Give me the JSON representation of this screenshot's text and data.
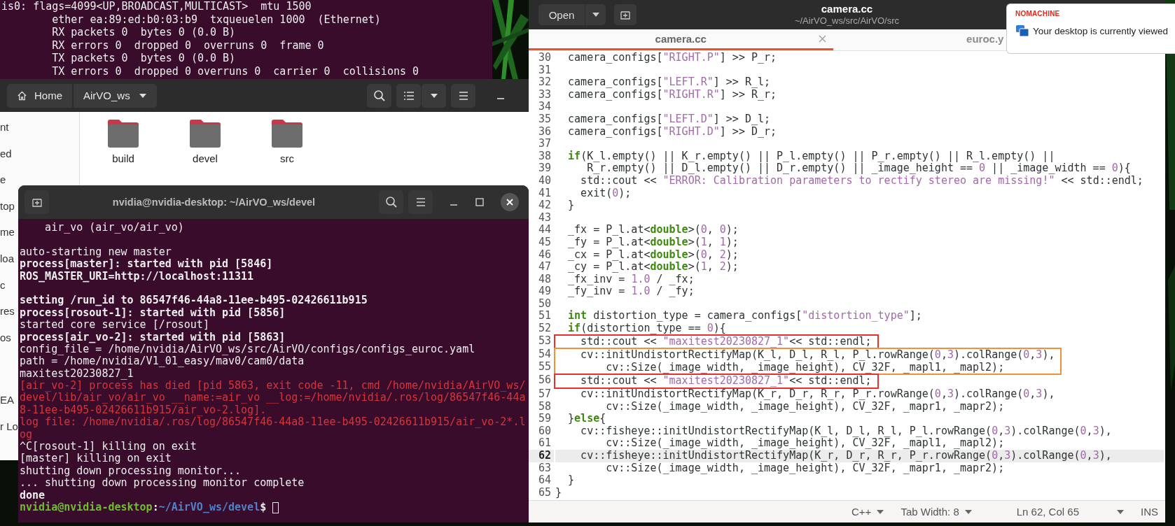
{
  "background_terminal": {
    "lines": [
      {
        "text": "is0: flags=4099<UP,BROADCAST,MULTICAST>  mtu 1500"
      },
      {
        "text": "        ether ea:89:ed:b0:03:b9  txqueuelen 1000  (Ethernet)"
      },
      {
        "text": "        RX packets 0  bytes 0 (0.0 B)"
      },
      {
        "text": "        RX errors 0  dropped 0  overruns 0  frame 0"
      },
      {
        "text": "        TX packets 0  bytes 0 (0.0 B)"
      },
      {
        "text": "        TX errors 0  dropped 0 overruns 0  carrier 0  collisions 0"
      }
    ]
  },
  "file_manager": {
    "breadcrumbs": [
      {
        "label": "Home",
        "kind": "home"
      },
      {
        "label": "AirVO_ws",
        "kind": "current"
      }
    ],
    "sidebar": {
      "items": [
        {
          "label": "nt"
        },
        {
          "label": "ed"
        },
        {
          "label": "e"
        },
        {
          "label": "top"
        },
        {
          "label": "me"
        },
        {
          "label": "loa"
        },
        {
          "label": "c"
        },
        {
          "label": "res"
        },
        {
          "label": "os"
        }
      ],
      "other": [
        {
          "label": "EA"
        },
        {
          "label": "r Lo"
        }
      ]
    },
    "folders": [
      {
        "name": "build"
      },
      {
        "name": "devel"
      },
      {
        "name": "src"
      }
    ]
  },
  "terminal": {
    "title": "nvidia@nvidia-desktop: ~/AirVO_ws/devel",
    "lines": [
      {
        "kind": "plain",
        "text": "    air_vo (air_vo/air_vo)"
      },
      {
        "kind": "blank"
      },
      {
        "kind": "plain",
        "text": "auto-starting new master"
      },
      {
        "kind": "bold",
        "text": "process[master]: started with pid [5846]"
      },
      {
        "kind": "bold",
        "text": "ROS_MASTER_URI=http://localhost:11311"
      },
      {
        "kind": "blank"
      },
      {
        "kind": "bold",
        "text": "setting /run_id to 86547f46-44a8-11ee-b495-02426611b915"
      },
      {
        "kind": "bold",
        "text": "process[rosout-1]: started with pid [5856]"
      },
      {
        "kind": "plain",
        "text": "started core service [/rosout]"
      },
      {
        "kind": "bold",
        "text": "process[air_vo-2]: started with pid [5863]"
      },
      {
        "kind": "plain",
        "text": "config_file = /home/nvidia/AirVO_ws/src/AirVO/configs/configs_euroc.yaml"
      },
      {
        "kind": "plain",
        "text": "path = /home/nvidia/V1_01_easy/mav0/cam0/data"
      },
      {
        "kind": "plain",
        "text": "maxitest20230827_1"
      },
      {
        "kind": "error",
        "text": "[air_vo-2] process has died [pid 5863, exit code -11, cmd /home/nvidia/AirVO_ws/"
      },
      {
        "kind": "error",
        "text": "devel/lib/air_vo/air_vo __name:=air_vo __log:=/home/nvidia/.ros/log/86547f46-44a"
      },
      {
        "kind": "error",
        "text": "8-11ee-b495-02426611b915/air_vo-2.log]."
      },
      {
        "kind": "error",
        "text": "log file: /home/nvidia/.ros/log/86547f46-44a8-11ee-b495-02426611b915/air_vo-2*.l"
      },
      {
        "kind": "error",
        "text": "og"
      },
      {
        "kind": "plain",
        "text": "^C[rosout-1] killing on exit"
      },
      {
        "kind": "plain",
        "text": "[master] killing on exit"
      },
      {
        "kind": "plain",
        "text": "shutting down processing monitor..."
      },
      {
        "kind": "plain",
        "text": "... shutting down processing monitor complete"
      },
      {
        "kind": "bold",
        "text": "done"
      }
    ],
    "prompt": {
      "user": "nvidia@nvidia-desktop",
      "separator": ":",
      "path": "~/AirVO_ws/devel",
      "symbol": "$"
    }
  },
  "editor": {
    "open_button": "Open",
    "title": "camera.cc",
    "subtitle": "~/AirVO_ws/src/AirVO/src",
    "tabs": [
      {
        "label": "camera.cc",
        "selected": true
      },
      {
        "label": "euroc.y",
        "selected": false
      }
    ],
    "code_blocks": [
      {
        "lines": [
          {
            "number": "30",
            "current": false,
            "tokens": [
              {
                "kind": "plain",
                "text": "  camera_configs["
              },
              {
                "kind": "string",
                "text": "\"RIGHT.P\""
              },
              {
                "kind": "plain",
                "text": "] >> P_r;"
              }
            ]
          },
          {
            "number": "31",
            "current": false
          },
          {
            "number": "32",
            "current": false,
            "tokens": [
              {
                "kind": "plain",
                "text": "  camera_configs["
              },
              {
                "kind": "string",
                "text": "\"LEFT.R\""
              },
              {
                "kind": "plain",
                "text": "] >> R_l;"
              }
            ]
          },
          {
            "number": "33",
            "current": false,
            "tokens": [
              {
                "kind": "plain",
                "text": "  camera_configs["
              },
              {
                "kind": "string",
                "text": "\"RIGHT.R\""
              },
              {
                "kind": "plain",
                "text": "] >> R_r;"
              }
            ]
          },
          {
            "number": "34",
            "current": false
          },
          {
            "number": "35",
            "current": false,
            "tokens": [
              {
                "kind": "plain",
                "text": "  camera_configs["
              },
              {
                "kind": "string",
                "text": "\"LEFT.D\""
              },
              {
                "kind": "plain",
                "text": "] >> D_l;"
              }
            ]
          },
          {
            "number": "36",
            "current": false,
            "tokens": [
              {
                "kind": "plain",
                "text": "  camera_configs["
              },
              {
                "kind": "string",
                "text": "\"RIGHT.D\""
              },
              {
                "kind": "plain",
                "text": "] >> D_r;"
              }
            ]
          },
          {
            "number": "37",
            "current": false
          },
          {
            "number": "38",
            "current": false,
            "tokens": [
              {
                "kind": "keyword",
                "text": "  if"
              },
              {
                "kind": "plain",
                "text": "(K_l.empty() || K_r.empty() || P_l.empty() || P_r.empty() || R_l.empty() ||"
              }
            ]
          },
          {
            "number": "39",
            "current": false,
            "tokens": [
              {
                "kind": "plain",
                "text": "     R_r.empty() || D_l.empty() || D_r.empty() || _image_height == "
              },
              {
                "kind": "number",
                "text": "0"
              },
              {
                "kind": "plain",
                "text": " || _image_width == "
              },
              {
                "kind": "number",
                "text": "0"
              },
              {
                "kind": "plain",
                "text": "){"
              }
            ]
          },
          {
            "number": "40",
            "current": false,
            "tokens": [
              {
                "kind": "plain",
                "text": "    std::cout << "
              },
              {
                "kind": "string",
                "text": "\"ERROR: Calibration parameters to rectify stereo are missing!\""
              },
              {
                "kind": "plain",
                "text": " << std::endl;"
              }
            ]
          },
          {
            "number": "41",
            "current": false,
            "tokens": [
              {
                "kind": "plain",
                "text": "    exit("
              },
              {
                "kind": "number",
                "text": "0"
              },
              {
                "kind": "plain",
                "text": ");"
              }
            ]
          },
          {
            "number": "42",
            "current": false,
            "tokens": [
              {
                "kind": "plain",
                "text": "  }"
              }
            ]
          },
          {
            "number": "43",
            "current": false
          },
          {
            "number": "44",
            "current": false,
            "tokens": [
              {
                "kind": "plain",
                "text": "  _fx = P_l.at<"
              },
              {
                "kind": "keyword",
                "text": "double"
              },
              {
                "kind": "plain",
                "text": ">("
              },
              {
                "kind": "number",
                "text": "0"
              },
              {
                "kind": "plain",
                "text": ", "
              },
              {
                "kind": "number",
                "text": "0"
              },
              {
                "kind": "plain",
                "text": ");"
              }
            ]
          },
          {
            "number": "45",
            "current": false,
            "tokens": [
              {
                "kind": "plain",
                "text": "  _fy = P_l.at<"
              },
              {
                "kind": "keyword",
                "text": "double"
              },
              {
                "kind": "plain",
                "text": ">("
              },
              {
                "kind": "number",
                "text": "1"
              },
              {
                "kind": "plain",
                "text": ", "
              },
              {
                "kind": "number",
                "text": "1"
              },
              {
                "kind": "plain",
                "text": ");"
              }
            ]
          },
          {
            "number": "46",
            "current": false,
            "tokens": [
              {
                "kind": "plain",
                "text": "  _cx = P_l.at<"
              },
              {
                "kind": "keyword",
                "text": "double"
              },
              {
                "kind": "plain",
                "text": ">("
              },
              {
                "kind": "number",
                "text": "0"
              },
              {
                "kind": "plain",
                "text": ", "
              },
              {
                "kind": "number",
                "text": "2"
              },
              {
                "kind": "plain",
                "text": ");"
              }
            ]
          },
          {
            "number": "47",
            "current": false,
            "tokens": [
              {
                "kind": "plain",
                "text": "  _cy = P_l.at<"
              },
              {
                "kind": "keyword",
                "text": "double"
              },
              {
                "kind": "plain",
                "text": ">("
              },
              {
                "kind": "number",
                "text": "1"
              },
              {
                "kind": "plain",
                "text": ", "
              },
              {
                "kind": "number",
                "text": "2"
              },
              {
                "kind": "plain",
                "text": ");"
              }
            ]
          },
          {
            "number": "48",
            "current": false,
            "tokens": [
              {
                "kind": "plain",
                "text": "  _fx_inv = "
              },
              {
                "kind": "number",
                "text": "1.0"
              },
              {
                "kind": "plain",
                "text": " / _fx;"
              }
            ]
          },
          {
            "number": "49",
            "current": false,
            "tokens": [
              {
                "kind": "plain",
                "text": "  _fy_inv = "
              },
              {
                "kind": "number",
                "text": "1.0"
              },
              {
                "kind": "plain",
                "text": " / _fy;"
              }
            ]
          },
          {
            "number": "50",
            "current": false
          },
          {
            "number": "51",
            "current": false,
            "tokens": [
              {
                "kind": "keyword",
                "text": "  int"
              },
              {
                "kind": "plain",
                "text": " distortion_type = camera_configs["
              },
              {
                "kind": "string",
                "text": "\"distortion_type\""
              },
              {
                "kind": "plain",
                "text": "];"
              }
            ]
          },
          {
            "number": "52",
            "current": false,
            "tokens": [
              {
                "kind": "keyword",
                "text": "  if"
              },
              {
                "kind": "plain",
                "text": "(distortion_type == "
              },
              {
                "kind": "number",
                "text": "0"
              },
              {
                "kind": "plain",
                "text": "){"
              }
            ]
          }
        ]
      },
      {
        "color": "#e8312f",
        "lines": [
          {
            "number": "53",
            "current": false,
            "tokens": [
              {
                "kind": "plain",
                "text": "    std::cout << "
              },
              {
                "kind": "string",
                "text": "\"maxitest20230827_1\""
              },
              {
                "kind": "plain",
                "text": "<< std::endl;"
              }
            ]
          }
        ]
      },
      {
        "color": "#f0903a",
        "lines": [
          {
            "number": "54",
            "current": false,
            "tokens": [
              {
                "kind": "plain",
                "text": "    cv::initUndistortRectifyMap(K_l, D_l, R_l, P_l.rowRange("
              },
              {
                "kind": "number",
                "text": "0"
              },
              {
                "kind": "plain",
                "text": ","
              },
              {
                "kind": "number",
                "text": "3"
              },
              {
                "kind": "plain",
                "text": ").colRange("
              },
              {
                "kind": "number",
                "text": "0"
              },
              {
                "kind": "plain",
                "text": ","
              },
              {
                "kind": "number",
                "text": "3"
              },
              {
                "kind": "plain",
                "text": "),"
              }
            ]
          },
          {
            "number": "55",
            "current": false,
            "tokens": [
              {
                "kind": "plain",
                "text": "        cv::Size(_image_width, _image_height), CV_32F, _mapl1, _mapl2);"
              }
            ]
          }
        ]
      },
      {
        "color": "#e8312f",
        "lines": [
          {
            "number": "56",
            "current": false,
            "tokens": [
              {
                "kind": "plain",
                "text": "    std::cout << "
              },
              {
                "kind": "string",
                "text": "\"maxitest20230827_1\""
              },
              {
                "kind": "plain",
                "text": "<< std::endl;"
              }
            ]
          }
        ]
      },
      {
        "lines": [
          {
            "number": "57",
            "current": false,
            "tokens": [
              {
                "kind": "plain",
                "text": "    cv::initUndistortRectifyMap(K_r, D_r, R_r, P_r.rowRange("
              },
              {
                "kind": "number",
                "text": "0"
              },
              {
                "kind": "plain",
                "text": ","
              },
              {
                "kind": "number",
                "text": "3"
              },
              {
                "kind": "plain",
                "text": ").colRange("
              },
              {
                "kind": "number",
                "text": "0"
              },
              {
                "kind": "plain",
                "text": ","
              },
              {
                "kind": "number",
                "text": "3"
              },
              {
                "kind": "plain",
                "text": "),"
              }
            ]
          },
          {
            "number": "58",
            "current": false,
            "tokens": [
              {
                "kind": "plain",
                "text": "        cv::Size(_image_width, _image_height), CV_32F, _mapr1, _mapr2);"
              }
            ]
          },
          {
            "number": "59",
            "current": false,
            "tokens": [
              {
                "kind": "plain",
                "text": "  }"
              },
              {
                "kind": "keyword",
                "text": "else"
              },
              {
                "kind": "plain",
                "text": "{"
              }
            ]
          },
          {
            "number": "60",
            "current": false,
            "tokens": [
              {
                "kind": "plain",
                "text": "    cv::fisheye::initUndistortRectifyMap(K_l, D_l, R_l, P_l.rowRange("
              },
              {
                "kind": "number",
                "text": "0"
              },
              {
                "kind": "plain",
                "text": ","
              },
              {
                "kind": "number",
                "text": "3"
              },
              {
                "kind": "plain",
                "text": ").colRange("
              },
              {
                "kind": "number",
                "text": "0"
              },
              {
                "kind": "plain",
                "text": ","
              },
              {
                "kind": "number",
                "text": "3"
              },
              {
                "kind": "plain",
                "text": "),"
              }
            ]
          },
          {
            "number": "61",
            "current": false,
            "tokens": [
              {
                "kind": "plain",
                "text": "        cv::Size(_image_width, _image_height), CV_32F, _mapl1, _mapl2);"
              }
            ]
          },
          {
            "number": "62",
            "current": true,
            "tokens": [
              {
                "kind": "plain",
                "text": "    cv::fisheye::initUndistortRectifyMap(K_r, D_r, R_r, P_r.rowRange("
              },
              {
                "kind": "number",
                "text": "0"
              },
              {
                "kind": "plain",
                "text": ","
              },
              {
                "kind": "number",
                "text": "3"
              },
              {
                "kind": "plain",
                "text": ").colRange("
              },
              {
                "kind": "number",
                "text": "0"
              },
              {
                "kind": "plain",
                "text": ","
              },
              {
                "kind": "number",
                "text": "3"
              },
              {
                "kind": "plain",
                "text": "),"
              }
            ]
          },
          {
            "number": "63",
            "current": false,
            "tokens": [
              {
                "kind": "plain",
                "text": "        cv::Size(_image_width, _image_height), CV_32F, _mapr1, _mapr2);"
              }
            ]
          },
          {
            "number": "64",
            "current": false,
            "tokens": [
              {
                "kind": "plain",
                "text": "  }"
              }
            ]
          },
          {
            "number": "65",
            "current": false,
            "tokens": [
              {
                "kind": "plain",
                "text": "}"
              }
            ]
          }
        ]
      }
    ],
    "status_bar": {
      "language": "C++",
      "tab_width": "Tab Width: 8",
      "position": "Ln 62, Col 65",
      "mode": "INS"
    }
  },
  "notification": {
    "brand": "NOMACHINE",
    "message": "Your desktop is currently viewed"
  }
}
